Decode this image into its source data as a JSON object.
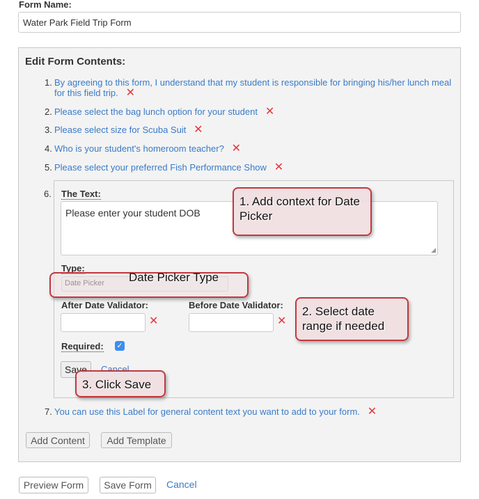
{
  "form_name": {
    "label": "Form Name:",
    "value": "Water Park Field Trip Form"
  },
  "edit": {
    "heading": "Edit Form Contents:",
    "items": [
      {
        "num": "1.",
        "text": "By agreeing to this form, I understand that my student is responsible for bringing his/her lunch meal for this field trip."
      },
      {
        "num": "2.",
        "text": "Please select the bag lunch option for your student"
      },
      {
        "num": "3.",
        "text": "Please select size for Scuba Suit"
      },
      {
        "num": "4.",
        "text": "Who is your student's homeroom teacher?"
      },
      {
        "num": "5.",
        "text": "Please select your preferred Fish Performance Show"
      },
      {
        "num": "6."
      },
      {
        "num": "7.",
        "text": "You can use this Label for general content text you want to add to your form."
      }
    ],
    "editor": {
      "text_label": "The Text:",
      "text_value": "Please enter your student DOB",
      "type_label": "Type:",
      "type_value": "Date Picker",
      "after_label": "After Date Validator:",
      "before_label": "Before Date Validator:",
      "required_label": "Required:",
      "required_checked": true,
      "save": "Save",
      "cancel": "Cancel"
    },
    "add_content": "Add Content",
    "add_template": "Add Template"
  },
  "footer": {
    "preview": "Preview Form",
    "save": "Save Form",
    "cancel": "Cancel"
  },
  "callouts": {
    "c1": "1. Add context for Date Picker",
    "type": "Date Picker Type",
    "c2": "2. Select date range if needed",
    "c3": "3. Click Save"
  },
  "colors": {
    "link": "#3a7bc8",
    "delete": "#e8343a",
    "callout_border": "#c0393f",
    "checkbox": "#3b8ef0"
  },
  "delete_icon": "x-icon"
}
